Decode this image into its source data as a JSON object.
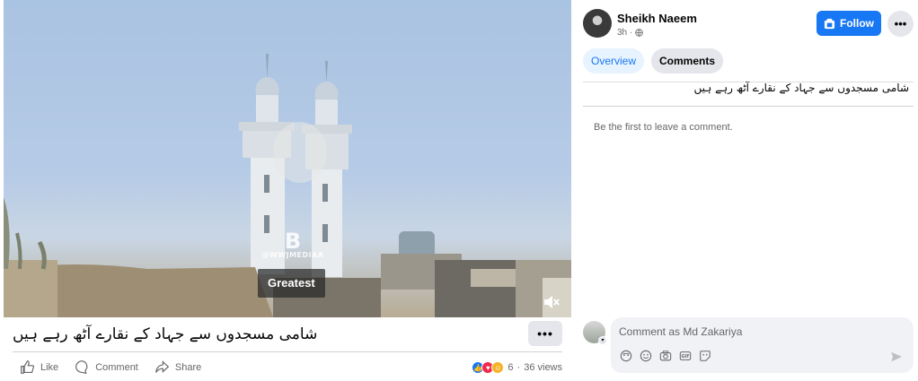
{
  "video": {
    "watermark_logo": "B",
    "watermark_text": "@WWJMEDIAA",
    "caption": "Greatest",
    "mute_icon": "speaker-muted-icon"
  },
  "post": {
    "title": "شامی مسجدوں سے جہاد کے نقارے آٹھ رہے ہیں",
    "more_label": "•••",
    "actions": {
      "like": "Like",
      "comment": "Comment",
      "share": "Share"
    },
    "reactions_count": "6",
    "separator": "·",
    "views": "36 views"
  },
  "panel": {
    "author": "Sheikh Naeem",
    "time": "3h ·",
    "follow_label": "Follow",
    "more_label": "•••",
    "tabs": [
      {
        "label": "Overview"
      },
      {
        "label": "Comments"
      }
    ],
    "description": "شامی مسجدوں سے جہاد کے نقارے آٹھ رہے ہیں",
    "empty_comments": "Be the first to leave a comment.",
    "comment_placeholder": "Comment as Md Zakariya"
  },
  "colors": {
    "brand": "#1877f2",
    "muted_text": "#65676b",
    "surface": "#f0f2f5",
    "button_grey": "#e4e6eb"
  }
}
